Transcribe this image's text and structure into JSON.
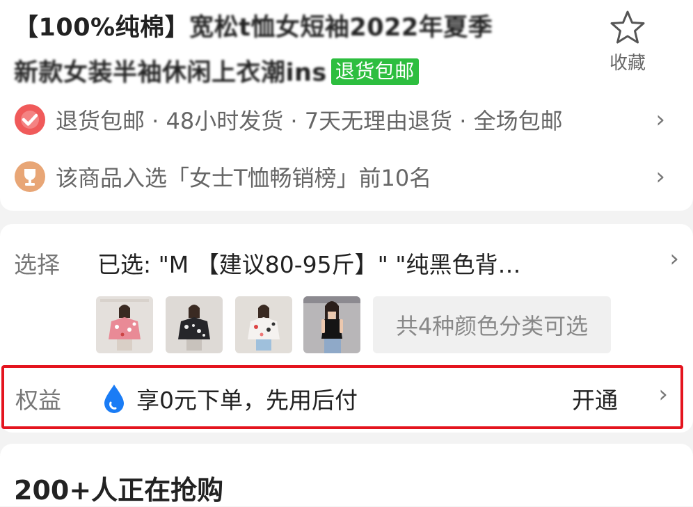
{
  "product": {
    "title_prefix": "【100%纯棉】",
    "title_blurred_1": "宽松t恤女短袖2022年夏季",
    "title_blurred_2": "新款女装半袖休闲上衣潮ins",
    "tag": "退货包邮"
  },
  "favorite": {
    "label": "收藏",
    "icon": "star-outline-icon"
  },
  "service": {
    "text": "退货包邮 · 48小时发货 · 7天无理由退货 · 全场包邮",
    "icon": "check-badge-icon",
    "icon_color": "#f05a5a"
  },
  "ranking": {
    "text": "该商品入选「女士T恤畅销榜」前10名",
    "icon": "trophy-icon",
    "icon_color": "#e8a676"
  },
  "selection": {
    "label": "选择",
    "value": "已选: \"M 【建议80-95斤】\" \"纯黑色背…",
    "more_label": "共4种颜色分类可选",
    "thumbnails": [
      "pink-floral-shirt",
      "black-print-shirt",
      "white-floral-shirt",
      "black-tank-top"
    ]
  },
  "benefit": {
    "label": "权益",
    "text": "享0元下单，先用后付",
    "action": "开通",
    "icon": "water-drop-icon",
    "icon_color": "#1a7cf5"
  },
  "bottom": {
    "title": "200+人正在抢购"
  },
  "chevron": "›"
}
